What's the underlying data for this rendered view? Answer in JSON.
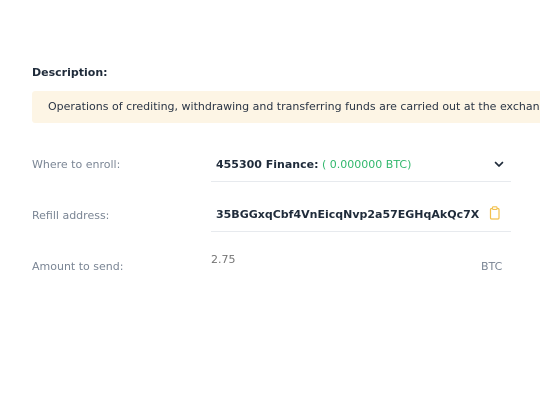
{
  "description": {
    "label": "Description:",
    "notice": "Operations of crediting, withdrawing and transferring funds are carried out at the exchange r"
  },
  "enroll": {
    "label": "Where to enroll:",
    "account": "455300 Finance:",
    "balance": "( 0.000000 BTC)",
    "icon": "chevron-down-icon"
  },
  "refill": {
    "label": "Refill address:",
    "address": "35BGGxqCbf4VnEicqNvp2a57EGHqAkQc7X",
    "icon": "copy-icon"
  },
  "amount": {
    "label": "Amount to send:",
    "value": "2.75",
    "currency": "BTC"
  },
  "colors": {
    "notice_bg": "#fdf5e5",
    "balance_green": "#33b86e",
    "copy_icon": "#f2c14e"
  }
}
